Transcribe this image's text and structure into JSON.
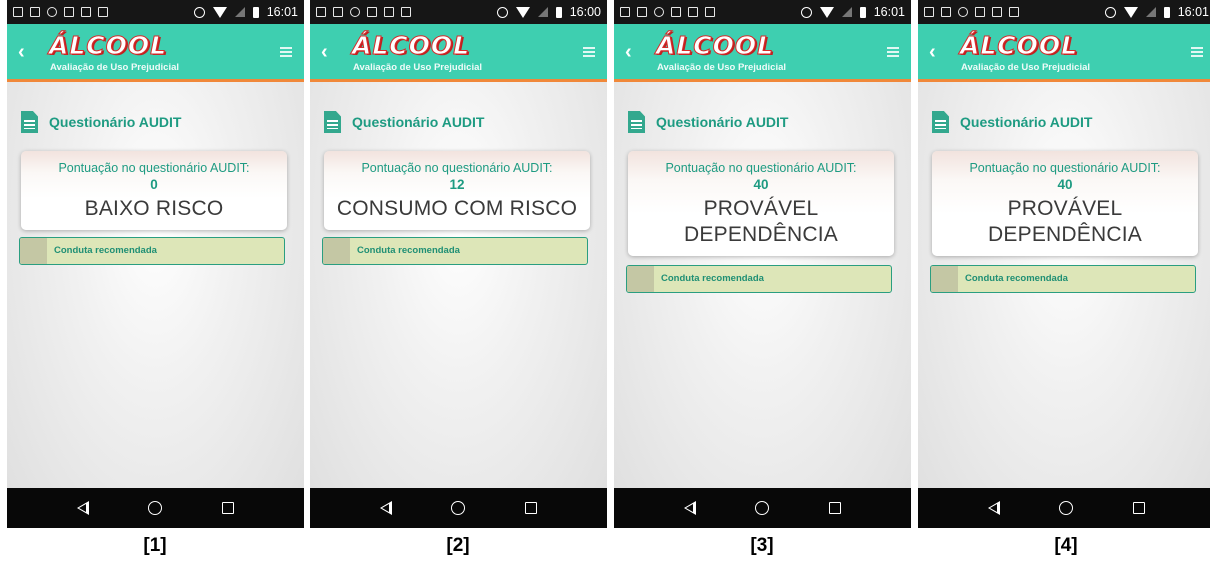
{
  "app": {
    "logo_text": "ÁLCOOL",
    "subtitle": "Avaliação de Uso Prejudicial",
    "section_title": "Questionário AUDIT",
    "score_label": "Pontuação no questionário AUDIT:",
    "conduta_label": "Conduta recomendada"
  },
  "colors": {
    "appbar": "#3ecfb0",
    "appbar_border": "#f0883a",
    "accent_text": "#1e9b82",
    "conduta_bg": "#dde6b8"
  },
  "icons": {
    "back": "chevron-left-icon",
    "menu": "hamburger-menu-icon",
    "section": "document-icon",
    "nav": [
      "nav-back-icon",
      "nav-home-icon",
      "nav-recent-icon"
    ]
  },
  "panels": [
    {
      "time": "16:01",
      "score": "0",
      "risk_line1": "BAIXO RISCO",
      "risk_line2": "",
      "caption": "[1]"
    },
    {
      "time": "16:00",
      "score": "12",
      "risk_line1": "CONSUMO COM RISCO",
      "risk_line2": "",
      "caption": "[2]"
    },
    {
      "time": "16:01",
      "score": "40",
      "risk_line1": "PROVÁVEL",
      "risk_line2": "DEPENDÊNCIA",
      "caption": "[3]"
    },
    {
      "time": "16:01",
      "score": "40",
      "risk_line1": "PROVÁVEL",
      "risk_line2": "DEPENDÊNCIA",
      "caption": "[4]"
    }
  ]
}
